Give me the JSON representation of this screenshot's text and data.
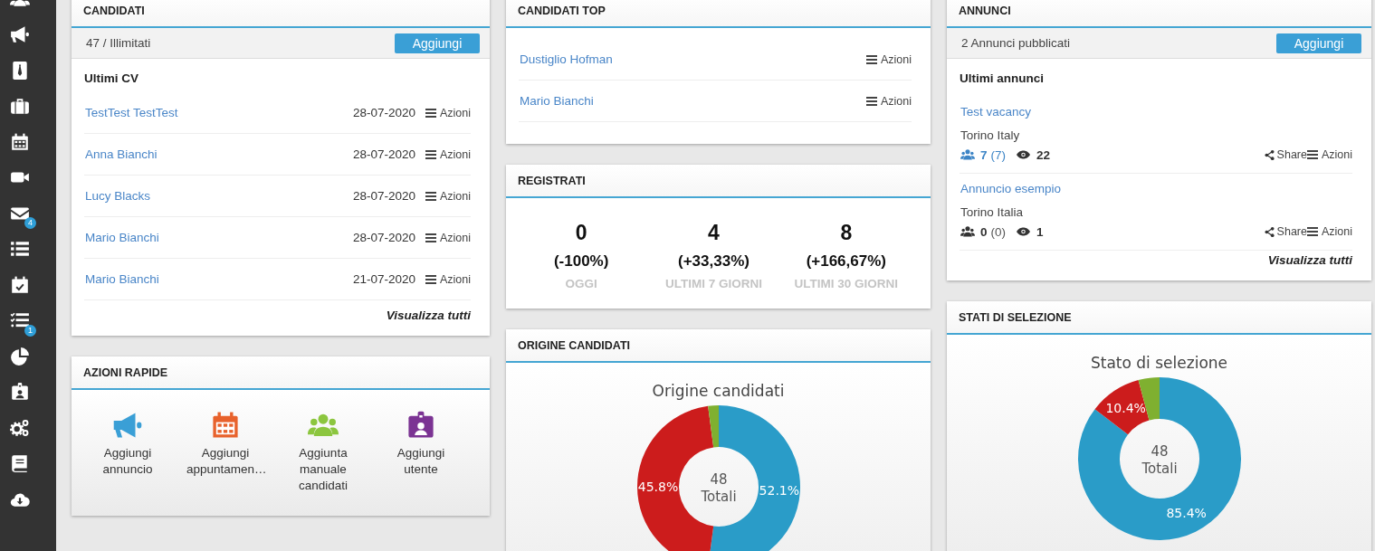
{
  "sidebar": {
    "items": [
      {
        "kind": "users"
      },
      {
        "kind": "megaphone"
      },
      {
        "kind": "tie"
      },
      {
        "kind": "briefcase"
      },
      {
        "kind": "calendar"
      },
      {
        "kind": "video"
      },
      {
        "kind": "mail",
        "badge": "4"
      },
      {
        "kind": "list"
      },
      {
        "kind": "calendar-check"
      },
      {
        "kind": "tasks",
        "badge": "1"
      },
      {
        "kind": "pie"
      },
      {
        "kind": "id-badge"
      },
      {
        "kind": "gears"
      },
      {
        "kind": "book"
      },
      {
        "kind": "cloud-download"
      }
    ]
  },
  "candidati": {
    "title": "CANDIDATI",
    "summary": "47 / Illimitati",
    "add_button": "Aggiungi",
    "list_title": "Ultimi CV",
    "rows": [
      {
        "name": "TestTest TestTest",
        "date": "28-07-2020",
        "action": "Azioni"
      },
      {
        "name": "Anna Bianchi",
        "date": "28-07-2020",
        "action": "Azioni"
      },
      {
        "name": "Lucy Blacks",
        "date": "28-07-2020",
        "action": "Azioni"
      },
      {
        "name": "Mario Bianchi",
        "date": "28-07-2020",
        "action": "Azioni"
      },
      {
        "name": "Mario Bianchi",
        "date": "21-07-2020",
        "action": "Azioni"
      }
    ],
    "view_all": "Visualizza tutti"
  },
  "azioni_rapide": {
    "title": "AZIONI RAPIDE",
    "items": [
      {
        "kind": "megaphone",
        "label": "Aggiungi annuncio",
        "color": "#3a9fd6"
      },
      {
        "kind": "calendar",
        "label": "Aggiungi appuntamen…",
        "color": "#e8622c"
      },
      {
        "kind": "users",
        "label": "Aggiunta manuale candidati",
        "color": "#8cc63f"
      },
      {
        "kind": "id-badge",
        "label": "Aggiungi utente",
        "color": "#7b3393"
      }
    ]
  },
  "candidati_top": {
    "title": "CANDIDATI TOP",
    "rows": [
      {
        "name": "Dustiglio Hofman",
        "action": "Azioni"
      },
      {
        "name": "Mario Bianchi",
        "action": "Azioni"
      }
    ]
  },
  "registrati": {
    "title": "REGISTRATI",
    "stats": [
      {
        "value": "0",
        "change": "(-100%)",
        "label": "OGGI"
      },
      {
        "value": "4",
        "change": "(+33,33%)",
        "label": "ULTIMI 7 GIORNI"
      },
      {
        "value": "8",
        "change": "(+166,67%)",
        "label": "ULTIMI 30 GIORNI"
      }
    ]
  },
  "origine_candidati": {
    "title": "ORIGINE CANDIDATI",
    "center_value": "48",
    "center_label": "Totali",
    "chart_data": {
      "type": "donut",
      "title": "Origine candidati",
      "values": [
        52.1,
        45.8,
        2.1
      ],
      "value_labels": [
        "52.1%",
        "45.8%",
        null
      ]
    }
  },
  "annunci": {
    "title": "ANNUNCI",
    "summary": "2 Annunci pubblicati",
    "add_button": "Aggiungi",
    "list_title": "Ultimi annunci",
    "items": [
      {
        "title": "Test vacancy",
        "location": "Torino Italy",
        "applicants": "7",
        "applicants_total": "(7)",
        "views": "22",
        "highlighted": true,
        "share": "Share",
        "action": "Azioni"
      },
      {
        "title": "Annuncio esempio",
        "location": "Torino Italia",
        "applicants": "0",
        "applicants_total": "(0)",
        "views": "1",
        "highlighted": false,
        "share": "Share",
        "action": "Azioni"
      }
    ],
    "view_all": "Visualizza tutti"
  },
  "stati_di_selezione": {
    "title": "STATI DI SELEZIONE",
    "center_value": "48",
    "center_label": "Totali",
    "chart_data": {
      "type": "donut",
      "title": "Stato di selezione",
      "values": [
        85.4,
        10.4,
        4.2
      ],
      "value_labels": [
        "85.4%",
        "10.4%",
        null
      ]
    }
  }
}
